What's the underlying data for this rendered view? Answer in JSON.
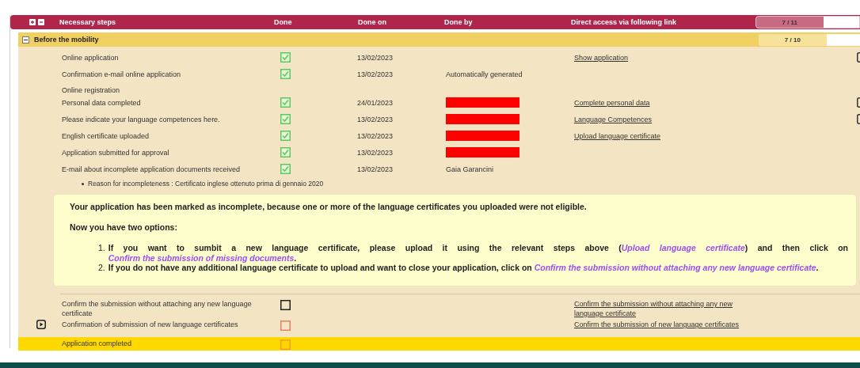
{
  "table": {
    "columns": [
      "Necessary steps",
      "Done",
      "Done on",
      "Done by",
      "Direct access via following link"
    ],
    "progress": {
      "label": "7 / 11",
      "level": 0.65
    }
  },
  "section": {
    "title": "Before the mobility",
    "expanded": true,
    "progress": {
      "label": "7 / 10",
      "level": 0.67
    },
    "rows": [
      {
        "kind": "step",
        "step": "Online application",
        "done": true,
        "color": "#5cc95c",
        "done_on": "13/02/2023",
        "link": "Show application",
        "action_icon": true
      },
      {
        "kind": "step",
        "step": "Confirmation e-mail online application",
        "done": true,
        "color": "#5cc95c",
        "done_on": "13/02/2023",
        "done_by": "Automatically generated"
      },
      {
        "kind": "label",
        "step": "Online registration"
      },
      {
        "kind": "step",
        "step": "Personal data completed",
        "done": true,
        "color": "#5cc95c",
        "done_on": "24/01/2023",
        "redacted": true,
        "link": "Complete personal data",
        "action_icon": true
      },
      {
        "kind": "step",
        "step": "Please indicate your language competences here.",
        "done": true,
        "color": "#5cc95c",
        "done_on": "13/02/2023",
        "redacted": true,
        "link": "Language Competences",
        "action_icon": true
      },
      {
        "kind": "step",
        "step": "English certificate uploaded",
        "done": true,
        "color": "#5cc95c",
        "done_on": "13/02/2023",
        "redacted": true,
        "link": "Upload language certificate"
      },
      {
        "kind": "step",
        "step": "Application submitted for approval",
        "done": true,
        "color": "#5cc95c",
        "done_on": "13/02/2023",
        "redacted": true
      },
      {
        "kind": "step",
        "step": "E-mail about incomplete application documents received",
        "done": true,
        "color": "#5cc95c",
        "done_on": "13/02/2023",
        "done_by": "Gaia Garancini"
      },
      {
        "kind": "note",
        "step": "Reason for incompleteness : Certificato inglese ottenuto prima di gennaio 2020"
      }
    ],
    "notice": {
      "paragraphs": [
        "Your application has been marked as incomplete, because one or more of the language certificates you uploaded were not eligible.",
        "Now you have two options:"
      ],
      "options": [
        [
          {
            "kind": "marker",
            "text": "1."
          },
          {
            "kind": "text",
            "text": "If you want to sumbit a new language certificate, please upload it using the relevant steps above ("
          },
          {
            "kind": "link",
            "text": "Upload language certificate"
          },
          {
            "kind": "text",
            "text": ") and then click on "
          },
          {
            "kind": "link",
            "text": "Confirm the submission of missing documents"
          },
          {
            "kind": "text",
            "text": "."
          }
        ],
        [
          {
            "kind": "marker",
            "text": "2."
          },
          {
            "kind": "text",
            "text": "If you do not have any additional language certificate to upload and want to close your application, click on "
          },
          {
            "kind": "link",
            "text": "Confirm the submission without attaching any new language certificate"
          },
          {
            "kind": "text",
            "text": "."
          }
        ]
      ]
    },
    "final_rows": [
      {
        "step": "Confirm the submission without attaching any new language certificate",
        "done": false,
        "color": "#222222",
        "link": "Confirm the submission without attaching any new language certificate",
        "current": false,
        "highlighted": false
      },
      {
        "step": "Confirmation of submission of new language certificates",
        "done": false,
        "color": "#e8806a",
        "link": "Confirm the submission of new language certificates",
        "current": true,
        "highlighted": false
      },
      {
        "step": "Application completed",
        "done": false,
        "color": "#f0a030",
        "current": false,
        "highlighted": true
      }
    ]
  }
}
